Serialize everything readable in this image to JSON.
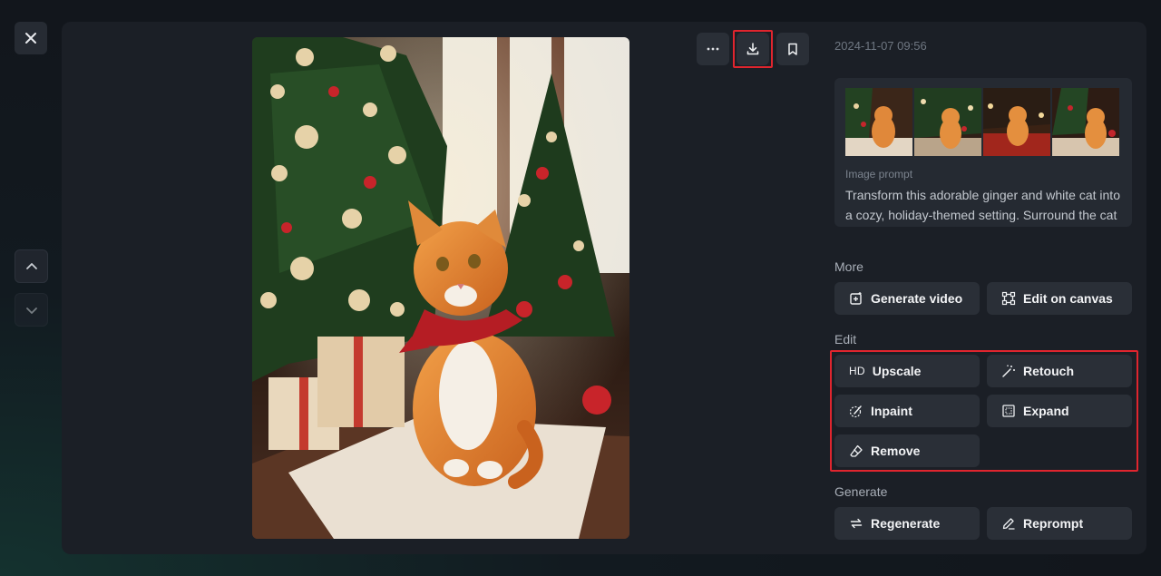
{
  "timestamp": "2024-11-07 09:56",
  "prompt": {
    "label": "Image prompt",
    "text": "Transform this adorable ginger and white cat into a cozy, holiday-themed setting. Surround the cat wit"
  },
  "sections": {
    "more": "More",
    "edit": "Edit",
    "generate": "Generate"
  },
  "actions": {
    "generate_video": "Generate video",
    "edit_on_canvas": "Edit on canvas",
    "upscale": "Upscale",
    "upscale_badge": "HD",
    "retouch": "Retouch",
    "inpaint": "Inpaint",
    "expand": "Expand",
    "remove": "Remove",
    "regenerate": "Regenerate",
    "reprompt": "Reprompt"
  },
  "icons": {
    "close": "close-icon",
    "up": "chevron-up-icon",
    "down": "chevron-down-icon",
    "more": "ellipsis-icon",
    "download": "download-icon",
    "bookmark": "bookmark-icon"
  },
  "colors": {
    "highlight": "#e0252e",
    "panel": "#1b1f26",
    "button": "#2a2f37"
  }
}
